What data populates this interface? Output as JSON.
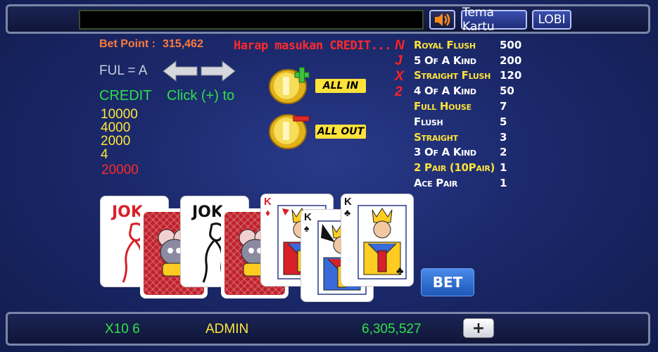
{
  "topbar": {
    "message": "",
    "sound_icon": "speaker-icon",
    "tema_label": "Tema Kartu",
    "lobi_label": "LOBI"
  },
  "info": {
    "bet_point_label": "Bet Point :",
    "bet_point_value": "315,462",
    "prompt": "Harap masukan CREDIT...",
    "ful_label": "FUL = A",
    "credit_label": "CREDIT",
    "click_hint": "Click (+) to",
    "credit_values": [
      "10000",
      "4000",
      "2000",
      "4"
    ],
    "credit_total": "20000"
  },
  "buttons": {
    "all_in": "ALL IN",
    "all_out": "ALL OUT",
    "bet": "BET",
    "plus": "+"
  },
  "njx": [
    "N",
    "J",
    "X",
    "2"
  ],
  "paytable": [
    {
      "hand": "Royal Flush",
      "payout": "500",
      "color": "#ffe23a"
    },
    {
      "hand": "5 Of A Kind",
      "payout": "200",
      "color": "#ffffff"
    },
    {
      "hand": "Straight Flush",
      "payout": "120",
      "color": "#ffe23a"
    },
    {
      "hand": "4 Of A Kind",
      "payout": "50",
      "color": "#ffffff"
    },
    {
      "hand": "Full House",
      "payout": "7",
      "color": "#ffe23a"
    },
    {
      "hand": "Flush",
      "payout": "5",
      "color": "#ffffff"
    },
    {
      "hand": "Straight",
      "payout": "3",
      "color": "#ffe23a"
    },
    {
      "hand": "3 Of A Kind",
      "payout": "2",
      "color": "#ffffff"
    },
    {
      "hand": "2 Pair (10Pair)",
      "payout": "1",
      "color": "#ffe23a"
    },
    {
      "hand": "Ace Pair",
      "payout": "1",
      "color": "#ffffff"
    }
  ],
  "cards": {
    "joker_label": "JOK",
    "king_rank": "K"
  },
  "bottombar": {
    "multiplier": "X10 6",
    "username": "ADMIN",
    "balance": "6,305,527"
  },
  "colors": {
    "green": "#2ee04a",
    "yellow": "#ffe63a",
    "red": "#ff2a2a",
    "orange": "#ff7a3a"
  }
}
